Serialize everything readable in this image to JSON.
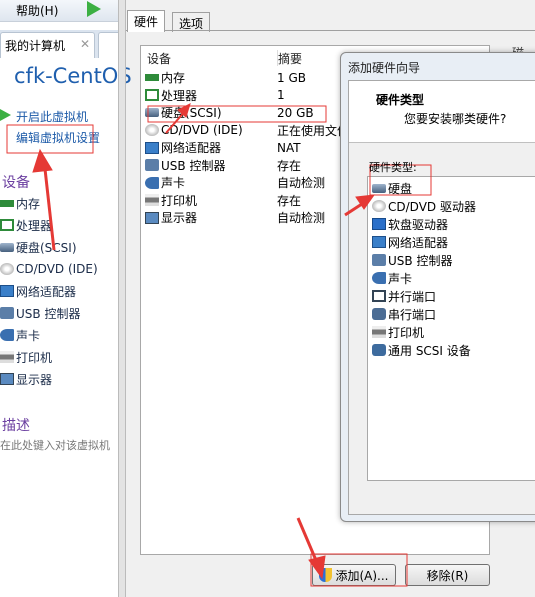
{
  "menubar": {
    "help": "帮助(H)"
  },
  "left": {
    "tab": "我的计算机",
    "vm_name": "cfk-CentOS",
    "power_on": "开启此虚拟机",
    "edit_settings": "编辑虚拟机设置",
    "devices_title": "设备",
    "devices": [
      {
        "label": "内存",
        "icon": "memory-icon"
      },
      {
        "label": "处理器",
        "icon": "cpu-icon"
      },
      {
        "label": "硬盘(SCSI)",
        "icon": "harddisk-icon"
      },
      {
        "label": "CD/DVD (IDE)",
        "icon": "cdrom-icon"
      },
      {
        "label": "网络适配器",
        "icon": "network-icon"
      },
      {
        "label": "USB 控制器",
        "icon": "usb-icon"
      },
      {
        "label": "声卡",
        "icon": "sound-icon"
      },
      {
        "label": "打印机",
        "icon": "printer-icon"
      },
      {
        "label": "显示器",
        "icon": "display-icon"
      }
    ],
    "desc_title": "描述",
    "desc_placeholder": "在此处键入对该虚拟机"
  },
  "settings": {
    "tabs": [
      "硬件",
      "选项"
    ],
    "col_device": "设备",
    "col_summary": "摘要",
    "right_partial": "磁盘",
    "rows": [
      {
        "device": "内存",
        "summary": "1 GB",
        "icon": "memory-icon"
      },
      {
        "device": "处理器",
        "summary": "1",
        "icon": "cpu-icon"
      },
      {
        "device": "硬盘(SCSI)",
        "summary": "20 GB",
        "icon": "harddisk-icon"
      },
      {
        "device": "CD/DVD (IDE)",
        "summary": "正在使用文件",
        "icon": "cdrom-icon"
      },
      {
        "device": "网络适配器",
        "summary": "NAT",
        "icon": "network-icon"
      },
      {
        "device": "USB 控制器",
        "summary": "存在",
        "icon": "usb-icon"
      },
      {
        "device": "声卡",
        "summary": "自动检测",
        "icon": "sound-icon"
      },
      {
        "device": "打印机",
        "summary": "存在",
        "icon": "printer-icon"
      },
      {
        "device": "显示器",
        "summary": "自动检测",
        "icon": "display-icon"
      }
    ],
    "add_button": "添加(A)...",
    "remove_button": "移除(R)"
  },
  "wizard": {
    "title": "添加硬件向导",
    "heading": "硬件类型",
    "subheading": "您要安装哪类硬件?",
    "list_label": "硬件类型:",
    "items": [
      {
        "label": "硬盘",
        "icon": "harddisk-icon"
      },
      {
        "label": "CD/DVD 驱动器",
        "icon": "cdrom-icon"
      },
      {
        "label": "软盘驱动器",
        "icon": "floppy-icon"
      },
      {
        "label": "网络适配器",
        "icon": "network-icon"
      },
      {
        "label": "USB 控制器",
        "icon": "usb-icon"
      },
      {
        "label": "声卡",
        "icon": "sound-icon"
      },
      {
        "label": "并行端口",
        "icon": "parallel-port-icon"
      },
      {
        "label": "串行端口",
        "icon": "serial-port-icon"
      },
      {
        "label": "打印机",
        "icon": "printer-icon"
      },
      {
        "label": "通用 SCSI 设备",
        "icon": "scsi-icon"
      }
    ]
  },
  "colors": {
    "annotation": "#e53935",
    "link": "#1c5aa8",
    "section": "#6b3fa0",
    "play": "#3cb043"
  }
}
